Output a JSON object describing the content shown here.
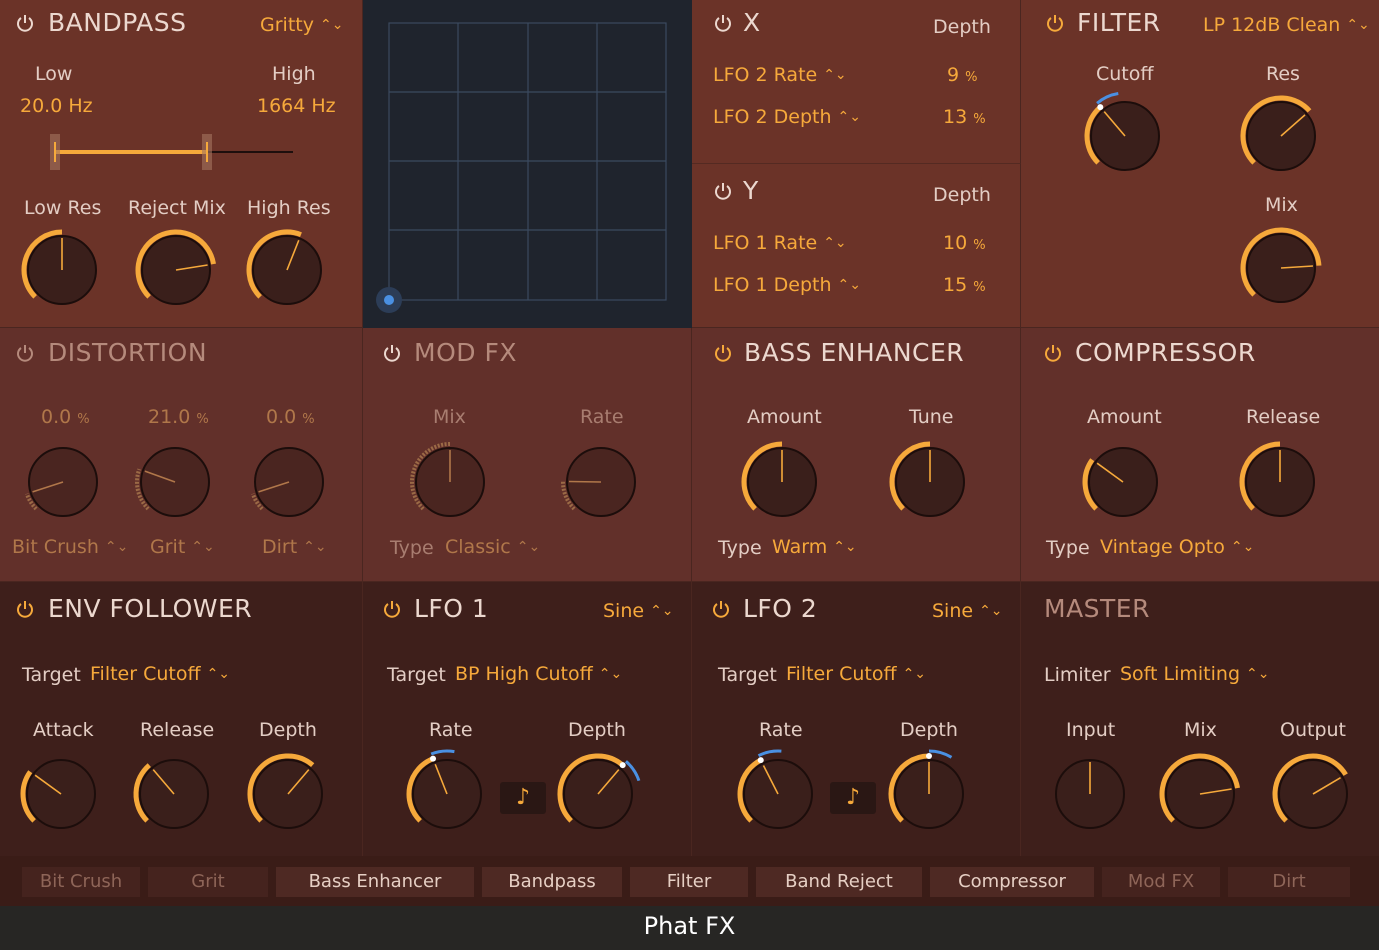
{
  "colors": {
    "accent": "#f6a93b",
    "mod_blue": "#4a90e2",
    "panel_top": "#6b3328",
    "panel_bottom": "#3e1f1b"
  },
  "bandpass": {
    "title": "BANDPASS",
    "mode": "Gritty",
    "low_label": "Low",
    "high_label": "High",
    "low_value": "20.0 Hz",
    "high_value": "1664 Hz",
    "knobs": {
      "low_res": {
        "label": "Low Res",
        "value": 0.5
      },
      "reject_mix": {
        "label": "Reject Mix",
        "value": 0.8
      },
      "high_res": {
        "label": "High Res",
        "value": 0.58
      }
    }
  },
  "xy_pad": {
    "puck_icon": "xy-puck"
  },
  "x_mod": {
    "title": "X",
    "depth_label": "Depth",
    "rows": [
      {
        "label": "LFO 2 Rate",
        "value": "9",
        "unit": "%"
      },
      {
        "label": "LFO 2 Depth",
        "value": "13",
        "unit": "%"
      }
    ]
  },
  "y_mod": {
    "title": "Y",
    "depth_label": "Depth",
    "rows": [
      {
        "label": "LFO 1 Rate",
        "value": "10",
        "unit": "%"
      },
      {
        "label": "LFO 1 Depth",
        "value": "15",
        "unit": "%"
      }
    ]
  },
  "filter": {
    "title": "FILTER",
    "mode": "LP 12dB Clean",
    "knobs": {
      "cutoff": {
        "label": "Cutoff",
        "value": 0.35
      },
      "res": {
        "label": "Res",
        "value": 0.68
      },
      "mix": {
        "label": "Mix",
        "value": 0.82
      }
    }
  },
  "distortion": {
    "title": "DISTORTION",
    "knobs": [
      {
        "readout": "0.0",
        "unit": "%",
        "type": "Bit Crush",
        "value": 0.1
      },
      {
        "readout": "21.0",
        "unit": "%",
        "type": "Grit",
        "value": 0.24
      },
      {
        "readout": "0.0",
        "unit": "%",
        "type": "Dirt",
        "value": 0.1
      }
    ]
  },
  "mod_fx": {
    "title": "MOD FX",
    "mix_label": "Mix",
    "rate_label": "Rate",
    "mix_value": 0.5,
    "rate_value": 0.17,
    "type_label": "Type",
    "type_value": "Classic"
  },
  "bass_enhancer": {
    "title": "BASS ENHANCER",
    "amount_label": "Amount",
    "tune_label": "Tune",
    "amount_value": 0.5,
    "tune_value": 0.5,
    "type_label": "Type",
    "type_value": "Warm"
  },
  "compressor": {
    "title": "COMPRESSOR",
    "amount_label": "Amount",
    "release_label": "Release",
    "amount_value": 0.3,
    "release_value": 0.5,
    "type_label": "Type",
    "type_value": "Vintage Opto"
  },
  "env_follower": {
    "title": "ENV FOLLOWER",
    "target_label": "Target",
    "target_value": "Filter Cutoff",
    "attack_label": "Attack",
    "release_label": "Release",
    "depth_label": "Depth",
    "attack_value": 0.3,
    "release_value": 0.35,
    "depth_value": 0.65
  },
  "lfo1": {
    "title": "LFO 1",
    "wave": "Sine",
    "target_label": "Target",
    "target_value": "BP High Cutoff",
    "rate_label": "Rate",
    "depth_label": "Depth",
    "rate_value": 0.42,
    "depth_value": 0.65,
    "note_icon": "note-icon"
  },
  "lfo2": {
    "title": "LFO 2",
    "wave": "Sine",
    "target_label": "Target",
    "target_value": "Filter Cutoff",
    "rate_label": "Rate",
    "depth_label": "Depth",
    "rate_value": 0.4,
    "depth_value": 0.5,
    "note_icon": "note-icon"
  },
  "master": {
    "title": "MASTER",
    "limiter_label": "Limiter",
    "limiter_value": "Soft Limiting",
    "input_label": "Input",
    "mix_label": "Mix",
    "output_label": "Output",
    "input_value": 0.5,
    "mix_value": 0.8,
    "output_value": 0.72
  },
  "order_bar": [
    {
      "label": "Bit Crush",
      "active": false
    },
    {
      "label": "Grit",
      "active": false
    },
    {
      "label": "Bass Enhancer",
      "active": true
    },
    {
      "label": "Bandpass",
      "active": true
    },
    {
      "label": "Filter",
      "active": true
    },
    {
      "label": "Band Reject",
      "active": true
    },
    {
      "label": "Compressor",
      "active": true
    },
    {
      "label": "Mod FX",
      "active": false
    },
    {
      "label": "Dirt",
      "active": false
    }
  ],
  "app_title": "Phat FX"
}
